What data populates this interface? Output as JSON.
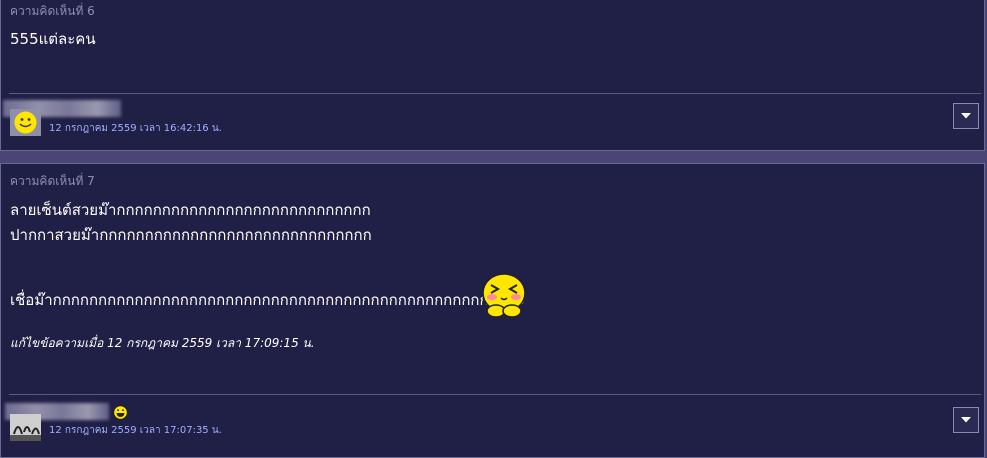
{
  "comments": [
    {
      "title": "ความคิดเห็นที่ 6",
      "body_lines": [
        "555แต่ละคน"
      ],
      "timestamp": "12 กรกฎาคม 2559 เวลา 16:42:16 น.",
      "avatar_icon": "smiley-face-icon"
    },
    {
      "title": "ความคิดเห็นที่ 7",
      "body_lines": [
        "ลายเซ็นต์สวยม๊ากกกกกกกกกกกกกกกกกกกกกกกกกกกก",
        "ปากกาสวยม๊ากกกกกกกกกกกกกกกกกกกกกกกกกกกกกก",
        "",
        "เชื่อม๊ากกกกกกกกกกกกกกกกกกกกกกกกกกกกกกกกกกกกกกกกกกกกกกกกกกค่ะ"
      ],
      "edited_note": "แก้ไขข้อความเมื่อ 12 กรกฎาคม 2559 เวลา 17:09:15 น.",
      "timestamp": "12 กรกฎาคม 2559 เวลา 17:07:35 น.",
      "inline_emoticon": "blushing-pleading-emoticon",
      "member_badge": "grinning-face-icon"
    }
  ],
  "colors": {
    "card_bg": "#201f45",
    "page_bg": "#4a4574",
    "title_text": "#8e8db8",
    "meta_text": "#9fb0ff",
    "body_text": "#ffffff"
  }
}
